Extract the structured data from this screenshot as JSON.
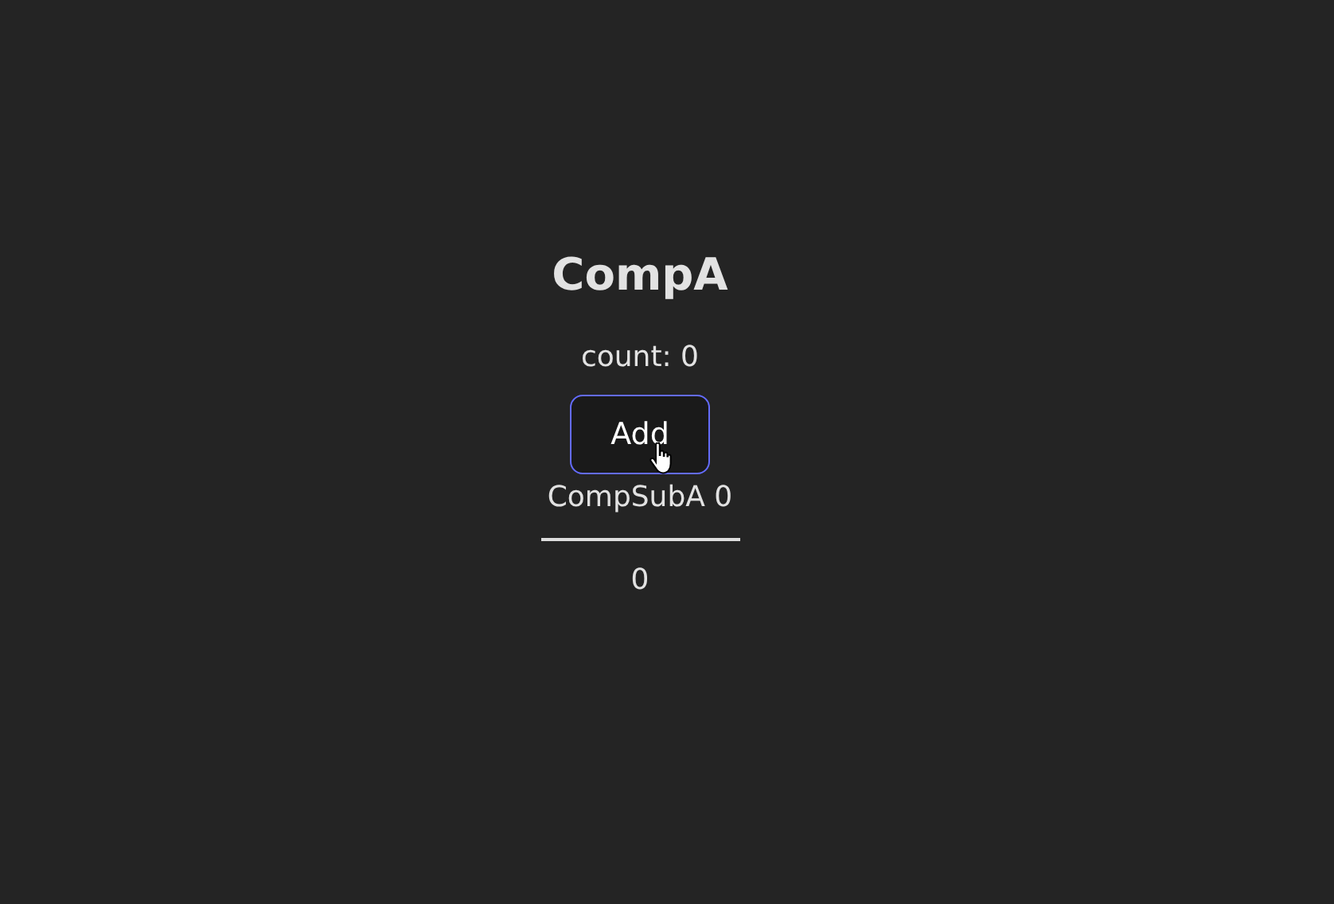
{
  "title": "CompA",
  "count_text": "count: 0",
  "add_button": {
    "label": "Add",
    "hovered": true
  },
  "sub": {
    "label": "CompSubA 0",
    "value": "0"
  }
}
